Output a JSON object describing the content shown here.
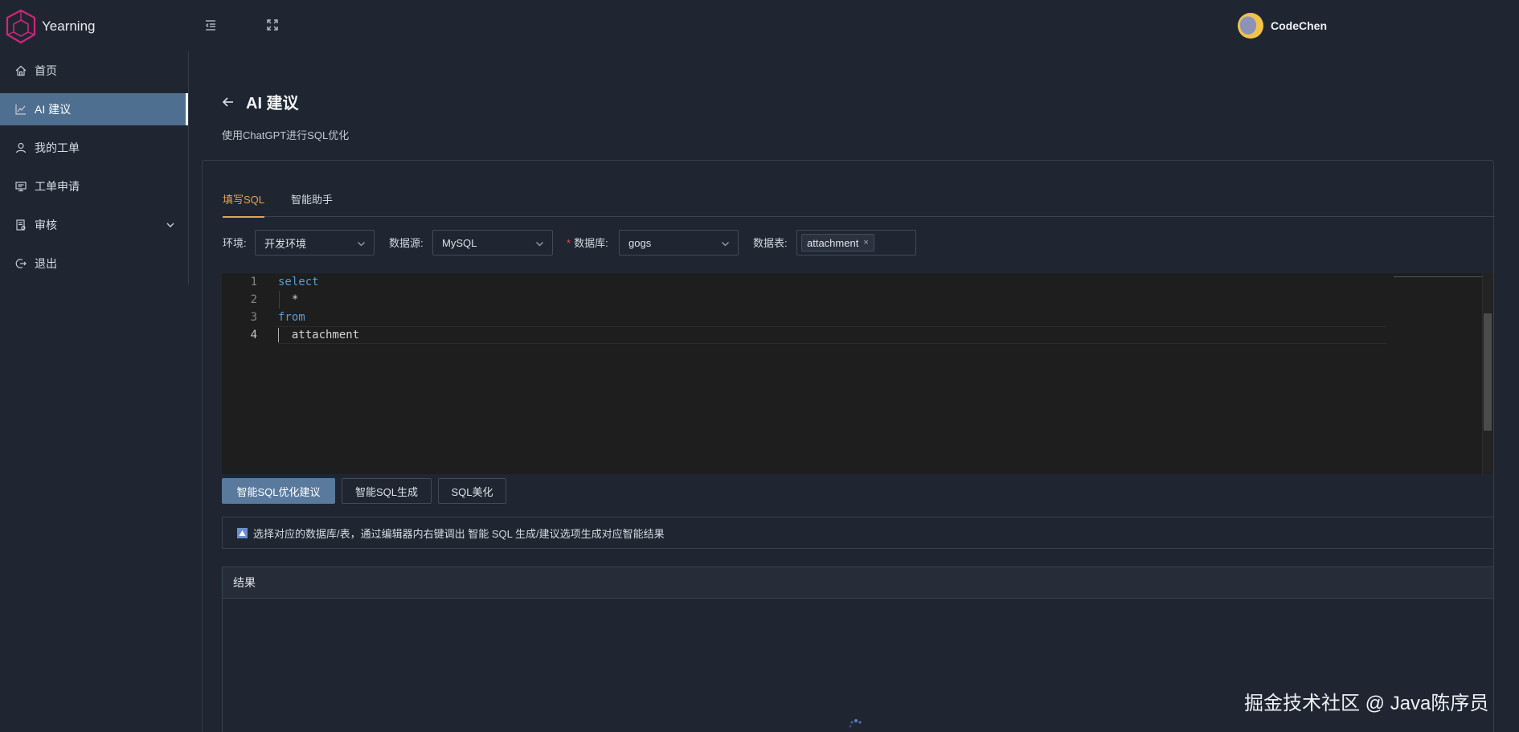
{
  "app": {
    "name": "Yearning"
  },
  "header": {
    "user_name": "CodeChen",
    "menu_toggle_icon": "menu-fold-icon",
    "fullscreen_icon": "fullscreen-icon"
  },
  "sidebar": {
    "items": [
      {
        "label": "首页",
        "icon": "home-icon"
      },
      {
        "label": "AI 建议",
        "icon": "chart-icon",
        "active": true
      },
      {
        "label": "我的工单",
        "icon": "user-icon"
      },
      {
        "label": "工单申请",
        "icon": "monitor-icon"
      },
      {
        "label": "审核",
        "icon": "audit-icon",
        "expandable": true
      },
      {
        "label": "退出",
        "icon": "logout-icon"
      }
    ]
  },
  "page": {
    "title": "AI 建议",
    "subtitle": "使用ChatGPT进行SQL优化"
  },
  "tabs": [
    {
      "label": "填写SQL",
      "active": true
    },
    {
      "label": "智能助手",
      "active": false
    }
  ],
  "filters": {
    "env": {
      "label": "环境:",
      "value": "开发环境"
    },
    "source": {
      "label": "数据源:",
      "value": "MySQL"
    },
    "database": {
      "required_mark": "*",
      "label": "数据库:",
      "value": "gogs"
    },
    "table": {
      "label": "数据表:",
      "tags": [
        "attachment"
      ],
      "tag_close": "×"
    }
  },
  "editor": {
    "lines": [
      {
        "num": "1",
        "text": "select",
        "kind": "keyword"
      },
      {
        "num": "2",
        "text": "  *",
        "kind": "plain"
      },
      {
        "num": "3",
        "text": "from",
        "kind": "keyword"
      },
      {
        "num": "4",
        "text": "  attachment",
        "kind": "plain"
      }
    ]
  },
  "actions": {
    "optimize": "智能SQL优化建议",
    "generate": "智能SQL生成",
    "beautify": "SQL美化"
  },
  "alert": {
    "text": "选择对应的数据库/表，通过编辑器内右键调出 智能 SQL 生成/建议选项生成对应智能结果"
  },
  "result": {
    "title": "结果"
  },
  "watermark": "掘金技术社区 @ Java陈序员",
  "colors": {
    "accent": "#e3a253",
    "primary": "#597a9d",
    "sidebar_active": "#4f6f91",
    "background": "#1f2632"
  }
}
